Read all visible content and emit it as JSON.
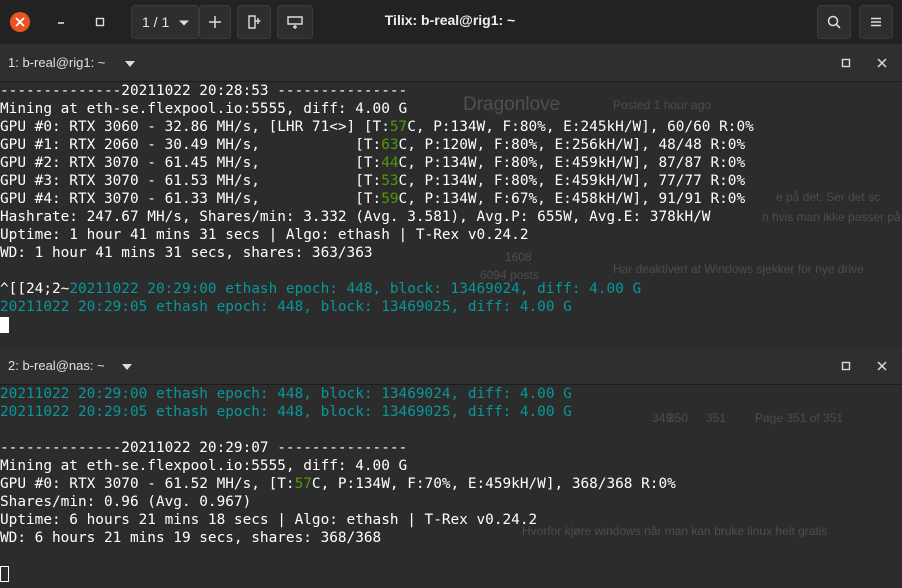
{
  "window": {
    "title": "Tilix: b-real@rig1: ~",
    "session_counter": "1 / 1"
  },
  "pane1": {
    "title": "1: b-real@rig1: ~",
    "lines": [
      "--------------20211022 20:28:53 ---------------",
      "Mining at eth-se.flexpool.io:5555, diff: 4.00 G",
      [
        "GPU #0: RTX 3060 - 32.86 MH/s, [LHR 71<>] [T:",
        "57",
        "C, P:134W, F:80%, E:245kH/W], 60/60 R:0%"
      ],
      [
        "GPU #1: RTX 2060 - 30.49 MH/s,           [T:",
        "63",
        "C, P:120W, F:80%, E:256kH/W], 48/48 R:0%"
      ],
      [
        "GPU #2: RTX 3070 - 61.45 MH/s,           [T:",
        "44",
        "C, P:134W, F:80%, E:459kH/W], 87/87 R:0%"
      ],
      [
        "GPU #3: RTX 3070 - 61.53 MH/s,           [T:",
        "53",
        "C, P:134W, F:80%, E:459kH/W], 77/77 R:0%"
      ],
      [
        "GPU #4: RTX 3070 - 61.33 MH/s,           [T:",
        "59",
        "C, P:134W, F:67%, E:458kH/W], 91/91 R:0%"
      ],
      "Hashrate: 247.67 MH/s, Shares/min: 3.332 (Avg. 3.581), Avg.P: 655W, Avg.E: 378kH/W",
      "Uptime: 1 hour 41 mins 31 secs | Algo: ethash | T-Rex v0.24.2",
      "WD: 1 hour 41 mins 31 secs, shares: 363/363",
      "",
      [
        "^[[24;2~",
        "20211022 20:29:00 ethash epoch: 448, block: 13469024, diff: 4.00 G"
      ],
      "20211022 20:29:05 ethash epoch: 448, block: 13469025, diff: 4.00 G"
    ]
  },
  "pane2": {
    "title": "2: b-real@nas: ~",
    "lines": [
      "20211022 20:29:00 ethash epoch: 448, block: 13469024, diff: 4.00 G",
      "20211022 20:29:05 ethash epoch: 448, block: 13469025, diff: 4.00 G",
      "",
      "--------------20211022 20:29:07 ---------------",
      "Mining at eth-se.flexpool.io:5555, diff: 4.00 G",
      [
        "GPU #0: RTX 3070 - 61.52 MH/s, [T:",
        "57",
        "C, P:134W, F:70%, E:459kH/W], 368/368 R:0%"
      ],
      "Shares/min: 0.96 (Avg. 0.967)",
      "Uptime: 6 hours 21 mins 18 secs | Algo: ethash | T-Rex v0.24.2",
      "WD: 6 hours 21 mins 19 secs, shares: 368/368"
    ]
  },
  "background_ghost": {
    "forum_user": "Dragonlove",
    "posted": "Posted 1 hour ago",
    "reply_fragment": "e på det. Ser det sc",
    "reply_fragment2": "n hvis man ikke passer på",
    "reputation": "1608",
    "post_count": "6094 posts",
    "quote": "Har deaktivert at Windows sjekker for nye drive",
    "pages": [
      "349",
      "350",
      "351"
    ],
    "page_label": "Page 351 of 351",
    "comment": "Hvorfor kjøre windows når man kan bruke linux helt gratis"
  },
  "colors": {
    "accent": "#e95420",
    "cyan": "#06989a",
    "green": "#4e9a06",
    "text": "#ffffff",
    "background": "#2c2c2c"
  },
  "icons": [
    "close-icon",
    "minimize-icon",
    "maximize-icon",
    "chevron-down-icon",
    "plus-icon",
    "add-right-icon",
    "add-down-icon",
    "search-icon",
    "menu-icon"
  ]
}
